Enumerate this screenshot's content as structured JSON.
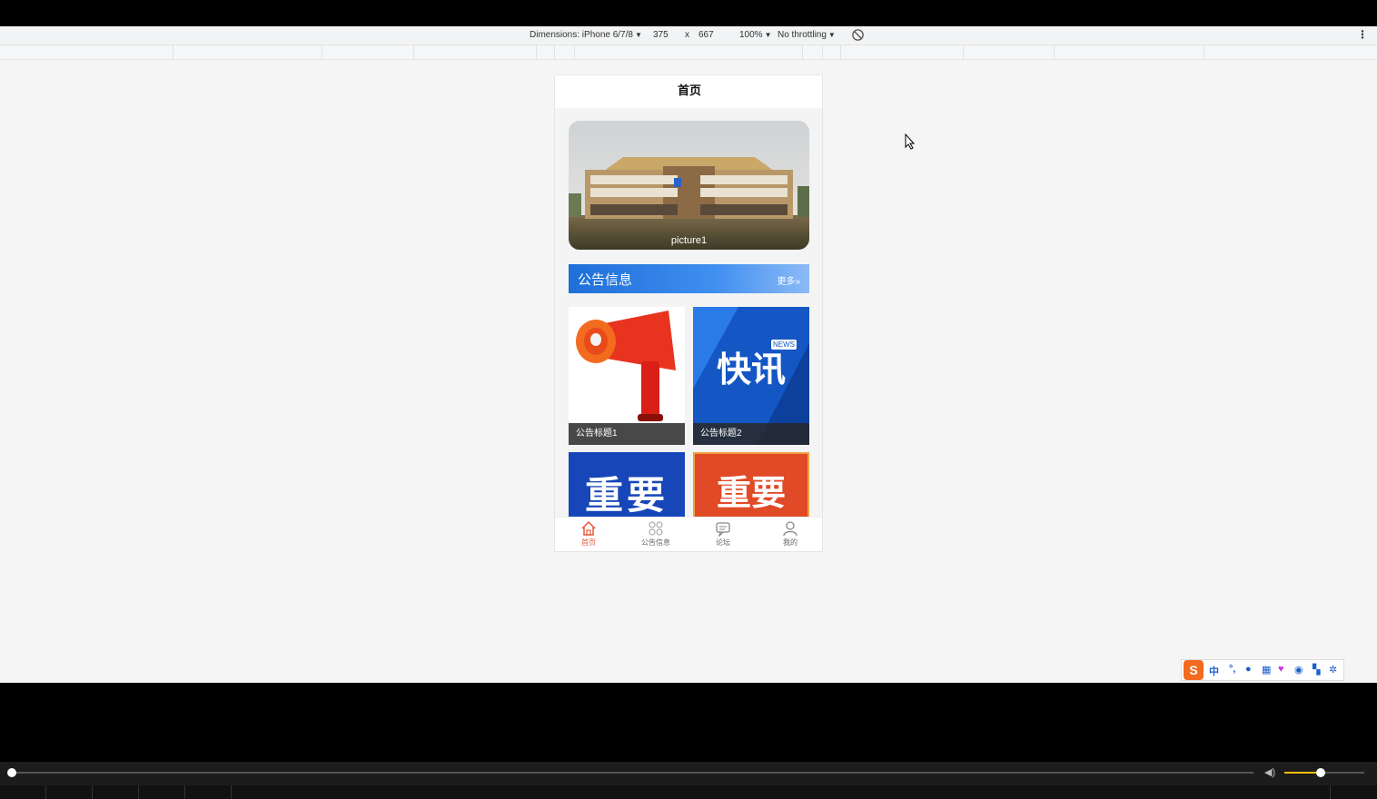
{
  "devtools": {
    "device_label": "Dimensions: iPhone 6/7/8",
    "width": "375",
    "times": "x",
    "height": "667",
    "zoom": "100%",
    "throttling": "No throttling",
    "rotate_icon": "rotate-icon",
    "menu_icon": "kebab-menu-icon"
  },
  "app": {
    "header_title": "首页",
    "banner": {
      "caption": "picture1"
    },
    "notice_section": {
      "title": "公告信息",
      "more_label": "更多"
    },
    "notices": [
      {
        "image_text": "",
        "caption": "公告标题1"
      },
      {
        "image_text": "快讯",
        "badge": "NEWS",
        "caption": "公告标题2"
      },
      {
        "image_text": "重要",
        "caption": ""
      },
      {
        "image_text": "重要",
        "caption": ""
      }
    ],
    "tabbar": [
      {
        "label": "首页",
        "icon": "home-icon",
        "active": true
      },
      {
        "label": "公告信息",
        "icon": "grid-icon",
        "active": false
      },
      {
        "label": "论坛",
        "icon": "chat-icon",
        "active": false
      },
      {
        "label": "我的",
        "icon": "user-icon",
        "active": false
      }
    ]
  },
  "ime": {
    "logo": "S",
    "mode": "中"
  },
  "player": {
    "progress": 0.0,
    "volume": 0.45
  },
  "colors": {
    "accent": "#e8573a",
    "notice_blue": "#1e6fd8"
  }
}
